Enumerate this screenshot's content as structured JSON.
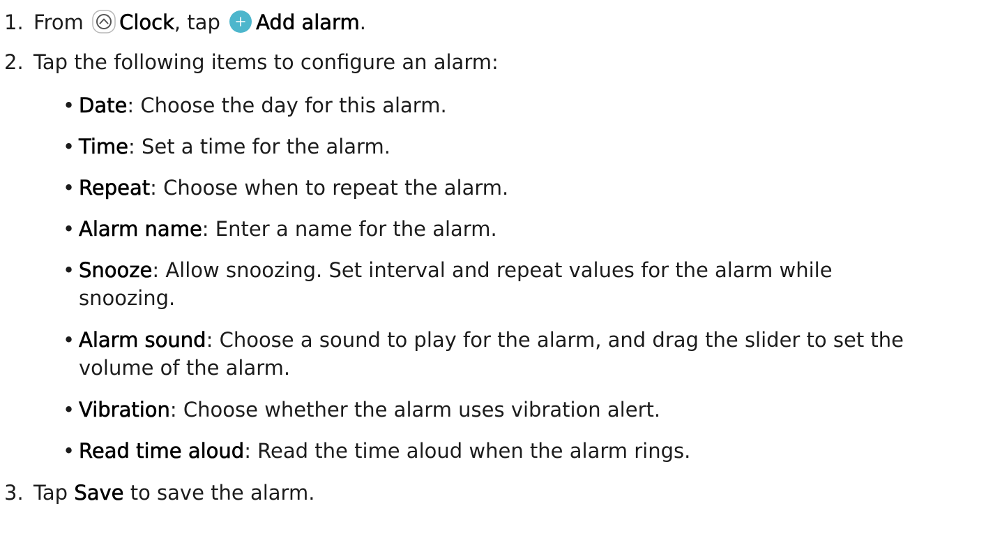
{
  "steps": [
    {
      "num": "1.",
      "from": "From",
      "clock_icon": "clock-app-icon",
      "clock_label": "Clock",
      "comma_tap": ", tap",
      "add_icon": "plus-circle-icon",
      "add_label": "Add alarm",
      "end": "."
    },
    {
      "num": "2.",
      "text": "Tap the following items to configure an alarm:"
    },
    {
      "num": "3.",
      "tap": "Tap",
      "save_label": "Save",
      "rest": "to save the alarm."
    }
  ],
  "bullets": [
    {
      "term": "Date",
      "desc": ": Choose the day for this alarm."
    },
    {
      "term": "Time",
      "desc": ": Set a time for the alarm."
    },
    {
      "term": "Repeat",
      "desc": ": Choose when to repeat the alarm."
    },
    {
      "term": "Alarm name",
      "desc": ": Enter a name for the alarm."
    },
    {
      "term": "Snooze",
      "desc": ": Allow snoozing. Set interval and repeat values for the alarm while snoozing."
    },
    {
      "term": "Alarm sound",
      "desc": ": Choose a sound to play for the alarm, and drag the slider to set the volume of the alarm."
    },
    {
      "term": "Vibration",
      "desc": ": Choose whether the alarm uses vibration alert."
    },
    {
      "term": "Read time aloud",
      "desc": ": Read the time aloud when the alarm rings."
    }
  ],
  "bullet_char": "•",
  "colors": {
    "add_icon_fill": "#4db6cc",
    "clock_icon_stroke": "#555555",
    "text": "#1c1c1c"
  }
}
